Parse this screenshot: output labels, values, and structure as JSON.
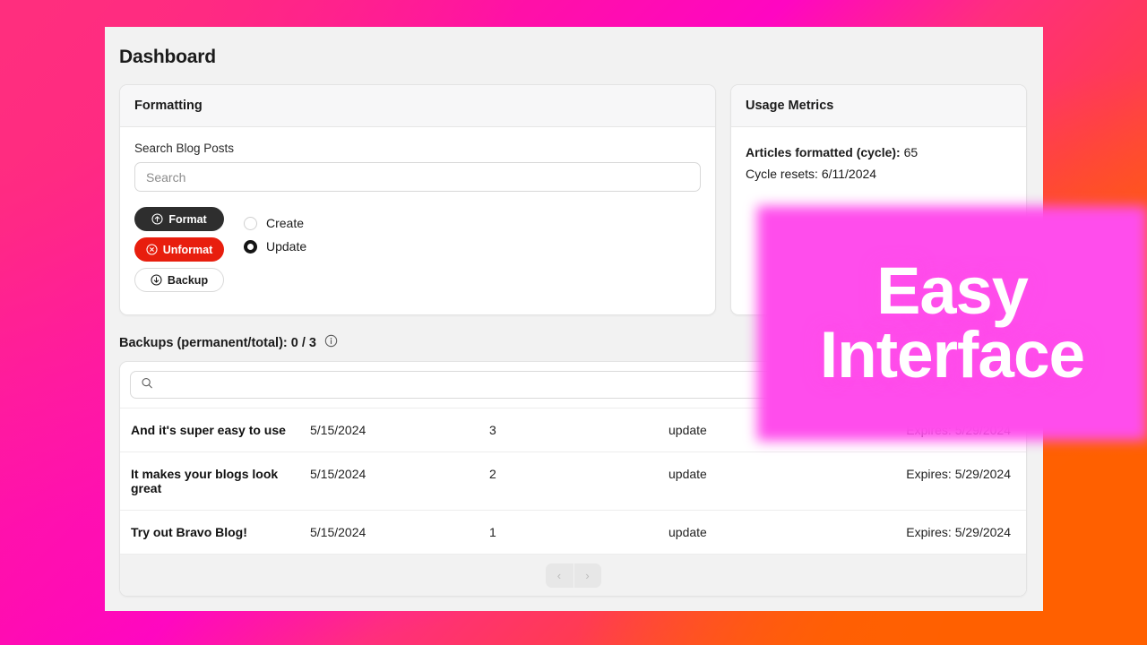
{
  "page": {
    "title": "Dashboard"
  },
  "formatting_card": {
    "header": "Formatting",
    "search_label": "Search Blog Posts",
    "search_placeholder": "Search",
    "search_value": "",
    "buttons": [
      {
        "label": "Format",
        "icon": "arrow-up-circle-icon",
        "style": "dark"
      },
      {
        "label": "Unformat",
        "icon": "x-circle-icon",
        "style": "danger"
      },
      {
        "label": "Backup",
        "icon": "arrow-down-circle-icon",
        "style": "light"
      }
    ],
    "radios": [
      {
        "label": "Create",
        "selected": false
      },
      {
        "label": "Update",
        "selected": true
      }
    ]
  },
  "usage_card": {
    "header": "Usage Metrics",
    "articles_label": "Articles formatted (cycle):",
    "articles_value": "65",
    "cycle_resets_label": "Cycle resets:",
    "cycle_resets_value": "6/11/2024"
  },
  "backups": {
    "heading": "Backups (permanent/total): 0 / 3",
    "info_icon": "info-circle-icon",
    "search_placeholder": "",
    "search_value": "",
    "search_icon": "search-icon",
    "rows": [
      {
        "title": "And it's super easy to use",
        "date": "5/15/2024",
        "count": "3",
        "action": "update",
        "expires": "Expires: 5/29/2024"
      },
      {
        "title": "It makes your blogs look great",
        "date": "5/15/2024",
        "count": "2",
        "action": "update",
        "expires": "Expires: 5/29/2024"
      },
      {
        "title": "Try out Bravo Blog!",
        "date": "5/15/2024",
        "count": "1",
        "action": "update",
        "expires": "Expires: 5/29/2024"
      }
    ],
    "pagination": {
      "prev_icon": "chevron-left-icon",
      "prev_label": "‹",
      "next_icon": "chevron-right-icon",
      "next_label": "›"
    }
  },
  "promo_overlay": {
    "line1": "Easy",
    "line2": "Interface",
    "glow_color": "#FF4DEC",
    "text_color": "#FFFFFF"
  },
  "theme": {
    "background_pink": "#FF2E7E",
    "background_magenta": "#FF06C2",
    "background_orange": "#FF6000",
    "danger": "#E81E0E",
    "dark": "#2E2E2E"
  }
}
